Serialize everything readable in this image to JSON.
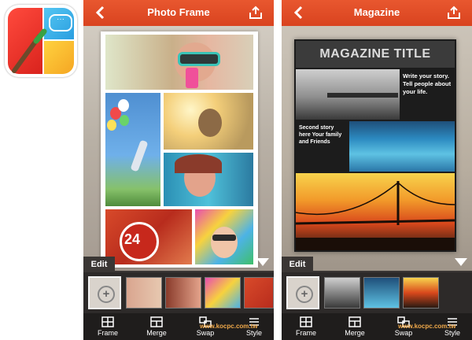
{
  "app_icon": {
    "name": "photo-collage-app-icon"
  },
  "screens": [
    {
      "title": "Photo Frame",
      "edit_label": "Edit",
      "tabs": [
        "Frame",
        "Merge",
        "Swap",
        "Style"
      ],
      "watermark": "www.kocpc.com.tw"
    },
    {
      "title": "Magazine",
      "edit_label": "Edit",
      "tabs": [
        "Frame",
        "Merge",
        "Swap",
        "Style"
      ],
      "watermark": "www.kocpc.com.tw",
      "magazine": {
        "title": "MAGAZINE TITLE",
        "story1": "Write your story. Tell people about your life.",
        "story2": "Second story here Your family and Friends"
      }
    }
  ],
  "colors": {
    "accent": "#e0502a",
    "dark": "#2d2a29"
  }
}
